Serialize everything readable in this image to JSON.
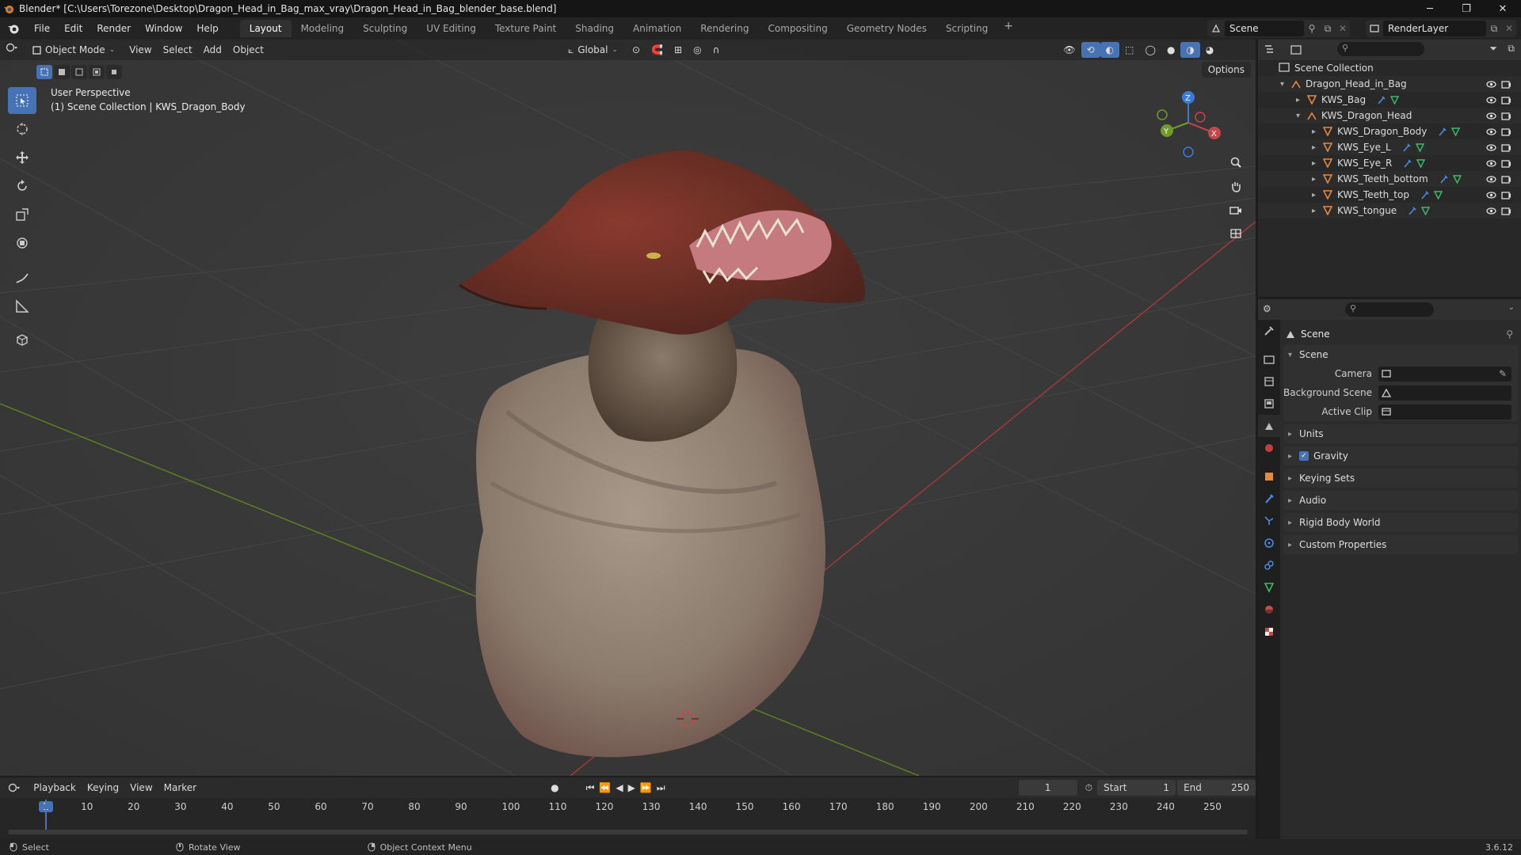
{
  "titlebar": {
    "title": "Blender* [C:\\Users\\Torezone\\Desktop\\Dragon_Head_in_Bag_max_vray\\Dragon_Head_in_Bag_blender_base.blend]",
    "minimize": "─",
    "maximize": "❐",
    "close": "✕"
  },
  "menubar": {
    "items": [
      "File",
      "Edit",
      "Render",
      "Window",
      "Help"
    ],
    "workspaces": [
      "Layout",
      "Modeling",
      "Sculpting",
      "UV Editing",
      "Texture Paint",
      "Shading",
      "Animation",
      "Rendering",
      "Compositing",
      "Geometry Nodes",
      "Scripting"
    ],
    "active_workspace": "Layout",
    "add": "+",
    "scene": "Scene",
    "render_layer": "RenderLayer"
  },
  "viewport": {
    "mode": "Object Mode",
    "menus": [
      "View",
      "Select",
      "Add",
      "Object"
    ],
    "orientation": "Global",
    "options": "Options",
    "perspective": "User Perspective",
    "collection_info": "(1) Scene Collection | KWS_Dragon_Body",
    "gizmo": {
      "x": "X",
      "y": "Y",
      "z": "Z"
    }
  },
  "outliner": {
    "root": "Scene Collection",
    "rows": [
      {
        "name": "Dragon_Head_in_Bag",
        "depth": 1,
        "expand": "▾"
      },
      {
        "name": "KWS_Bag",
        "depth": 2,
        "expand": "▸"
      },
      {
        "name": "KWS_Dragon_Head",
        "depth": 2,
        "expand": "▾"
      },
      {
        "name": "KWS_Dragon_Body",
        "depth": 3,
        "expand": "▸"
      },
      {
        "name": "KWS_Eye_L",
        "depth": 3,
        "expand": "▸"
      },
      {
        "name": "KWS_Eye_R",
        "depth": 3,
        "expand": "▸"
      },
      {
        "name": "KWS_Teeth_bottom",
        "depth": 3,
        "expand": "▸"
      },
      {
        "name": "KWS_Teeth_top",
        "depth": 3,
        "expand": "▸"
      },
      {
        "name": "KWS_tongue",
        "depth": 3,
        "expand": "▸"
      }
    ]
  },
  "properties": {
    "context": "Scene",
    "panel": "Scene",
    "camera_label": "Camera",
    "background_label": "Background Scene",
    "clip_label": "Active Clip",
    "subpanels": [
      "Units",
      "Gravity",
      "Keying Sets",
      "Audio",
      "Rigid Body World",
      "Custom Properties"
    ]
  },
  "timeline": {
    "menus": [
      "Playback",
      "Keying",
      "View",
      "Marker"
    ],
    "current_frame": "1",
    "start_label": "Start",
    "start": "1",
    "end_label": "End",
    "end": "250",
    "ticks": [
      "1",
      "10",
      "20",
      "30",
      "40",
      "50",
      "60",
      "70",
      "80",
      "90",
      "100",
      "110",
      "120",
      "130",
      "140",
      "150",
      "160",
      "170",
      "180",
      "190",
      "200",
      "210",
      "220",
      "230",
      "240",
      "250"
    ]
  },
  "statusbar": {
    "select": "Select",
    "rotate": "Rotate View",
    "context_menu": "Object Context Menu",
    "version": "3.6.12"
  },
  "colors": {
    "accent": "#4772b3",
    "x_axis": "#c8464a",
    "y_axis": "#6e9b2a",
    "z_axis": "#3b7bd8",
    "object_orange": "#e8893c"
  }
}
